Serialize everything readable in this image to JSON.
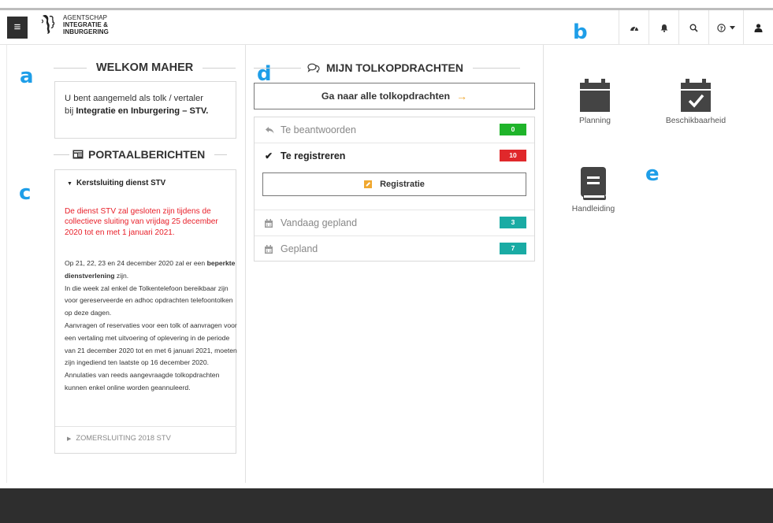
{
  "header": {
    "menu_label": "≡",
    "logo_lines": [
      "AGENTSCHAP",
      "INTEGRATIE &",
      "INBURGERING"
    ],
    "icons": [
      "dashboard-icon",
      "bell-icon",
      "search-icon",
      "help-icon",
      "caret-down-icon",
      "user-icon"
    ]
  },
  "annotations": {
    "a": "a",
    "b": "b",
    "c": "c",
    "d": "d",
    "e": "e"
  },
  "welcome": {
    "title": "WELKOM MAHER",
    "line1": "U bent aangemeld als tolk / vertaler",
    "line2_prefix": "bij ",
    "line2_bold": "Integratie en Inburgering – STV."
  },
  "portal": {
    "title": "PORTAALBERICHTEN",
    "item_open_title": "Kerstsluiting dienst STV",
    "item_open_red": "De dienst STV zal gesloten zijn tijdens de collectieve sluiting van vrijdag 25 december 2020 tot en met 1 januari 2021.",
    "body_p1_prefix": "Op 21, 22, 23 en 24 december 2020 zal er een ",
    "body_p1_bold": "beperkte dienstverlening",
    "body_p1_suffix": " zijn.",
    "body_p2": "In die week zal enkel de Tolkentelefoon bereikbaar zijn voor gereserveerde en adhoc opdrachten telefoontolken op deze dagen.",
    "body_p3": "Aanvragen of reservaties voor een tolk of aanvragen voor een vertaling met uitvoering of oplevering in de periode  van 21 december 2020 tot en met 6 januari 2021, moeten zijn ingediend ten laatste op 16 december 2020.",
    "body_p4": "Annulaties van reeds aangevraagde tolkopdrachten kunnen enkel online worden geannuleerd.",
    "item_collapsed_title": "ZOMERSLUITING 2018 STV"
  },
  "tasks": {
    "title": "MIJN TOLKOPDRACHTEN",
    "go_all_label": "Ga naar alle tolkopdrachten",
    "go_all_arrow": "→",
    "rows": [
      {
        "label": "Te beantwoorden",
        "count": "0",
        "color": "#1fb42a",
        "icon": "reply-icon"
      },
      {
        "label": "Te registreren",
        "count": "10",
        "color": "#e0282b",
        "icon": "check-icon"
      },
      {
        "label": "Vandaag gepland",
        "count": "3",
        "color": "#1aaba4",
        "icon": "calendar-icon"
      },
      {
        "label": "Gepland",
        "count": "7",
        "color": "#1aaba4",
        "icon": "calendar-icon"
      }
    ],
    "registration_label": "Registratie"
  },
  "tiles": [
    {
      "label": "Planning",
      "icon": "calendar-icon"
    },
    {
      "label": "Beschikbaarheid",
      "icon": "calendar-check-icon"
    },
    {
      "label": "Handleiding",
      "icon": "book-icon"
    }
  ]
}
